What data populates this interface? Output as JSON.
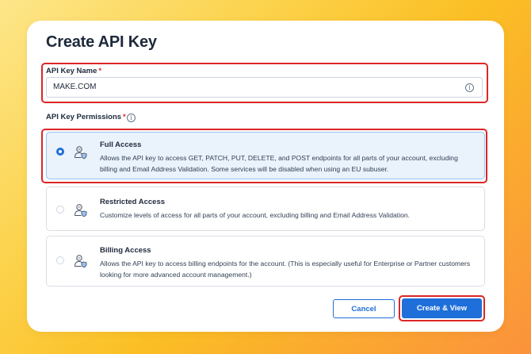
{
  "dialog": {
    "title": "Create API Key"
  },
  "api_key_name": {
    "label": "API Key Name",
    "required_marker": "*",
    "value": "MAKE.COM",
    "info_icon": "info-icon"
  },
  "permissions": {
    "label": "API Key Permissions",
    "required_marker": "*",
    "info_icon": "info-icon",
    "selected": "full_access",
    "options": [
      {
        "id": "full_access",
        "title": "Full Access",
        "description": "Allows the API key to access GET, PATCH, PUT, DELETE, and POST endpoints for all parts of your account, excluding billing and Email Address Validation. Some services will be disabled when using an EU subuser.",
        "icon": "user-shield-icon",
        "selected": true
      },
      {
        "id": "restricted_access",
        "title": "Restricted Access",
        "description": "Customize levels of access for all parts of your account, excluding billing and Email Address Validation.",
        "icon": "user-shield-icon",
        "selected": false
      },
      {
        "id": "billing_access",
        "title": "Billing Access",
        "description": "Allows the API key to access billing endpoints for the account. (This is especially useful for Enterprise or Partner customers looking for more advanced account management.)",
        "icon": "user-shield-icon",
        "selected": false
      }
    ]
  },
  "actions": {
    "cancel_label": "Cancel",
    "create_label": "Create & View"
  },
  "colors": {
    "primary": "#1e6fd9",
    "highlight_outline": "#dc2626",
    "required": "#dc2626",
    "selected_background": "#eaf2fc",
    "text": "#1e293b"
  }
}
